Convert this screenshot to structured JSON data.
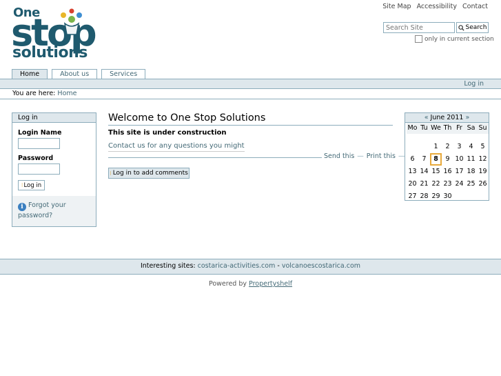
{
  "logo": {
    "line1": "One",
    "line2": "stop",
    "line3": "solutions"
  },
  "site_actions": [
    "Site Map",
    "Accessibility",
    "Contact"
  ],
  "search": {
    "placeholder": "Search Site",
    "button": "Search",
    "only_current": "only in current section"
  },
  "tabs": [
    {
      "label": "Home",
      "active": true
    },
    {
      "label": "About us"
    },
    {
      "label": "Services"
    }
  ],
  "personal_bar": {
    "login": "Log in"
  },
  "breadcrumbs": {
    "prefix": "You are here:",
    "home": "Home"
  },
  "login_portlet": {
    "title": "Log in",
    "login_name_label": "Login Name",
    "password_label": "Password",
    "button": "Log in",
    "forgot": "Forgot your password?"
  },
  "main": {
    "title": "Welcome to One Stop Solutions",
    "subtitle": "This site is under construction",
    "contact": "Contact us for any questions you might",
    "send_this": "Send this",
    "print_this": "Print this",
    "comment_button": "Log in to add comments"
  },
  "calendar": {
    "prev": "«",
    "month": "June 2011",
    "next": "»",
    "weekdays": [
      "Mo",
      "Tu",
      "We",
      "Th",
      "Fr",
      "Sa",
      "Su"
    ],
    "leading_blanks": 2,
    "days": [
      "1",
      "2",
      "3",
      "4",
      "5",
      "6",
      "7",
      "8",
      "9",
      "10",
      "11",
      "12",
      "13",
      "14",
      "15",
      "16",
      "17",
      "18",
      "19",
      "20",
      "21",
      "22",
      "23",
      "24",
      "25",
      "26",
      "27",
      "28",
      "29",
      "30"
    ],
    "today": "8"
  },
  "footer": {
    "prefix": "Interesting sites:",
    "site1": "costarica-activities.com",
    "sep": "-",
    "site2": "volcanoescostarica.com"
  },
  "colophon": {
    "prefix": "Powered by",
    "link": "Propertyshelf"
  },
  "colors": {
    "accent": "#436976",
    "border": "#8cacbb",
    "bar": "#dee7ec",
    "today": "#e8a93a"
  }
}
